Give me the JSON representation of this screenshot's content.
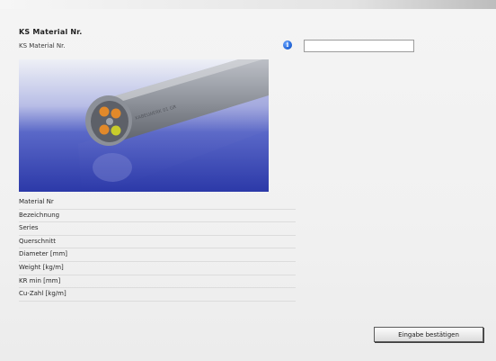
{
  "form": {
    "title": "KS Material Nr.",
    "field_label": "KS Material Nr.",
    "field_value": "",
    "info_icon": "i"
  },
  "product": {
    "image_icon": "cable-image",
    "cable_print": "KABELWERK 01 GR"
  },
  "properties": [
    "Material Nr",
    "Bezeichnung",
    "Series",
    "Querschnitt",
    "Diameter [mm]",
    "Weight [kg/m]",
    "KR min [mm]",
    "Cu-Zahl [kg/m]"
  ],
  "actions": {
    "confirm_label": "Eingabe bestätigen"
  },
  "colors": {
    "panel_bg": "#f1f1f1",
    "image_bg": "#3a4ab8",
    "info_icon": "#1b5fd3"
  }
}
